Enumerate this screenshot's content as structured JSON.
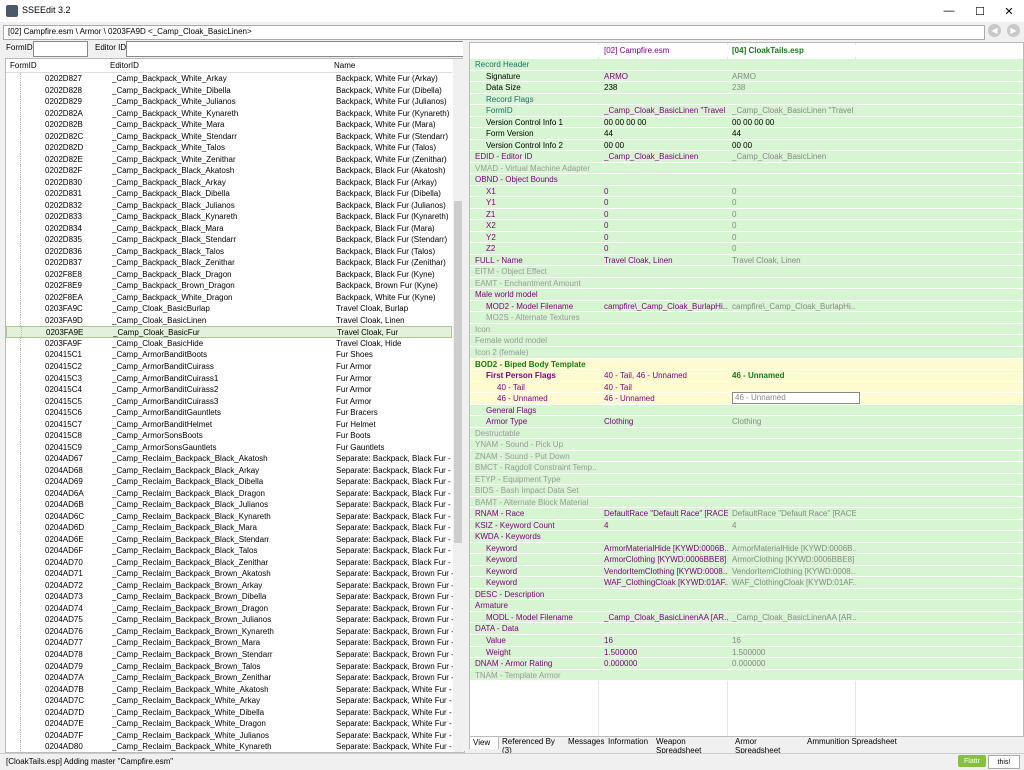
{
  "app": {
    "title": "SSEEdit 3.2"
  },
  "window_controls": {
    "minimize": "—",
    "maximize": "☐",
    "close": "✕"
  },
  "path": "[02] Campfire.esm \\ Armor \\ 0203FA9D <_Camp_Cloak_BasicLinen>",
  "filter": {
    "formid_label": "FormID",
    "editorid_label": "Editor ID",
    "formid_value": "",
    "editorid_value": ""
  },
  "left": {
    "headers": {
      "formid": "FormID",
      "editorid": "EditorID",
      "name": "Name"
    },
    "selected_index": 22,
    "rows": [
      [
        "0202D827",
        "_Camp_Backpack_White_Arkay",
        "Backpack, White Fur (Arkay)"
      ],
      [
        "0202D828",
        "_Camp_Backpack_White_Dibella",
        "Backpack, White Fur (Dibella)"
      ],
      [
        "0202D829",
        "_Camp_Backpack_White_Julianos",
        "Backpack, White Fur (Julianos)"
      ],
      [
        "0202D82A",
        "_Camp_Backpack_White_Kynareth",
        "Backpack, White Fur (Kynareth)"
      ],
      [
        "0202D82B",
        "_Camp_Backpack_White_Mara",
        "Backpack, White Fur (Mara)"
      ],
      [
        "0202D82C",
        "_Camp_Backpack_White_Stendarr",
        "Backpack, White Fur (Stendarr)"
      ],
      [
        "0202D82D",
        "_Camp_Backpack_White_Talos",
        "Backpack, White Fur (Talos)"
      ],
      [
        "0202D82E",
        "_Camp_Backpack_White_Zenithar",
        "Backpack, White Fur (Zenithar)"
      ],
      [
        "0202D82F",
        "_Camp_Backpack_Black_Akatosh",
        "Backpack, Black Fur (Akatosh)"
      ],
      [
        "0202D830",
        "_Camp_Backpack_Black_Arkay",
        "Backpack, Black Fur (Arkay)"
      ],
      [
        "0202D831",
        "_Camp_Backpack_Black_Dibella",
        "Backpack, Black Fur (Dibella)"
      ],
      [
        "0202D832",
        "_Camp_Backpack_Black_Julianos",
        "Backpack, Black Fur (Julianos)"
      ],
      [
        "0202D833",
        "_Camp_Backpack_Black_Kynareth",
        "Backpack, Black Fur (Kynareth)"
      ],
      [
        "0202D834",
        "_Camp_Backpack_Black_Mara",
        "Backpack, Black Fur (Mara)"
      ],
      [
        "0202D835",
        "_Camp_Backpack_Black_Stendarr",
        "Backpack, Black Fur (Stendarr)"
      ],
      [
        "0202D836",
        "_Camp_Backpack_Black_Talos",
        "Backpack, Black Fur (Talos)"
      ],
      [
        "0202D837",
        "_Camp_Backpack_Black_Zenithar",
        "Backpack, Black Fur (Zenithar)"
      ],
      [
        "0202F8E8",
        "_Camp_Backpack_Black_Dragon",
        "Backpack, Black Fur (Kyne)"
      ],
      [
        "0202F8E9",
        "_Camp_Backpack_Brown_Dragon",
        "Backpack, Brown Fur (Kyne)"
      ],
      [
        "0202F8EA",
        "_Camp_Backpack_White_Dragon",
        "Backpack, White Fur (Kyne)"
      ],
      [
        "0203FA9C",
        "_Camp_Cloak_BasicBurlap",
        "Travel Cloak, Burlap"
      ],
      [
        "0203FA9D",
        "_Camp_Cloak_BasicLinen",
        "Travel Cloak, Linen"
      ],
      [
        "0203FA9E",
        "_Camp_Cloak_BasicFur",
        "Travel Cloak, Fur"
      ],
      [
        "0203FA9F",
        "_Camp_Cloak_BasicHide",
        "Travel Cloak, Hide"
      ],
      [
        "020415C1",
        "_Camp_ArmorBanditBoots",
        "Fur Shoes"
      ],
      [
        "020415C2",
        "_Camp_ArmorBanditCuirass",
        "Fur Armor"
      ],
      [
        "020415C3",
        "_Camp_ArmorBanditCuirass1",
        "Fur Armor"
      ],
      [
        "020415C4",
        "_Camp_ArmorBanditCuirass2",
        "Fur Armor"
      ],
      [
        "020415C5",
        "_Camp_ArmorBanditCuirass3",
        "Fur Armor"
      ],
      [
        "020415C6",
        "_Camp_ArmorBanditGauntlets",
        "Fur Bracers"
      ],
      [
        "020415C7",
        "_Camp_ArmorBanditHelmet",
        "Fur Helmet"
      ],
      [
        "020415C8",
        "_Camp_ArmorSonsBoots",
        "Fur Boots"
      ],
      [
        "020415C9",
        "_Camp_ArmorSonsGauntlets",
        "Fur Gauntlets"
      ],
      [
        "0204AD67",
        "_Camp_Reclaim_Backpack_Black_Akatosh",
        "Separate: Backpack, Black Fur - ..."
      ],
      [
        "0204AD68",
        "_Camp_Reclaim_Backpack_Black_Arkay",
        "Separate: Backpack, Black Fur - ..."
      ],
      [
        "0204AD69",
        "_Camp_Reclaim_Backpack_Black_Dibella",
        "Separate: Backpack, Black Fur - ..."
      ],
      [
        "0204AD6A",
        "_Camp_Reclaim_Backpack_Black_Dragon",
        "Separate: Backpack, Black Fur - ..."
      ],
      [
        "0204AD6B",
        "_Camp_Reclaim_Backpack_Black_Julianos",
        "Separate: Backpack, Black Fur - ..."
      ],
      [
        "0204AD6C",
        "_Camp_Reclaim_Backpack_Black_Kynareth",
        "Separate: Backpack, Black Fur - ..."
      ],
      [
        "0204AD6D",
        "_Camp_Reclaim_Backpack_Black_Mara",
        "Separate: Backpack, Black Fur - ..."
      ],
      [
        "0204AD6E",
        "_Camp_Reclaim_Backpack_Black_Stendarr",
        "Separate: Backpack, Black Fur - ..."
      ],
      [
        "0204AD6F",
        "_Camp_Reclaim_Backpack_Black_Talos",
        "Separate: Backpack, Black Fur - ..."
      ],
      [
        "0204AD70",
        "_Camp_Reclaim_Backpack_Black_Zenithar",
        "Separate: Backpack, Black Fur - ..."
      ],
      [
        "0204AD71",
        "_Camp_Reclaim_Backpack_Brown_Akatosh",
        "Separate: Backpack, Brown Fur - ..."
      ],
      [
        "0204AD72",
        "_Camp_Reclaim_Backpack_Brown_Arkay",
        "Separate: Backpack, Brown Fur - ..."
      ],
      [
        "0204AD73",
        "_Camp_Reclaim_Backpack_Brown_Dibella",
        "Separate: Backpack, Brown Fur - ..."
      ],
      [
        "0204AD74",
        "_Camp_Reclaim_Backpack_Brown_Dragon",
        "Separate: Backpack, Brown Fur - ..."
      ],
      [
        "0204AD75",
        "_Camp_Reclaim_Backpack_Brown_Julianos",
        "Separate: Backpack, Brown Fur - ..."
      ],
      [
        "0204AD76",
        "_Camp_Reclaim_Backpack_Brown_Kynareth",
        "Separate: Backpack, Brown Fur - ..."
      ],
      [
        "0204AD77",
        "_Camp_Reclaim_Backpack_Brown_Mara",
        "Separate: Backpack, Brown Fur - ..."
      ],
      [
        "0204AD78",
        "_Camp_Reclaim_Backpack_Brown_Stendarr",
        "Separate: Backpack, Brown Fur - ..."
      ],
      [
        "0204AD79",
        "_Camp_Reclaim_Backpack_Brown_Talos",
        "Separate: Backpack, Brown Fur - ..."
      ],
      [
        "0204AD7A",
        "_Camp_Reclaim_Backpack_Brown_Zenithar",
        "Separate: Backpack, Brown Fur - ..."
      ],
      [
        "0204AD7B",
        "_Camp_Reclaim_Backpack_White_Akatosh",
        "Separate: Backpack, White Fur - ..."
      ],
      [
        "0204AD7C",
        "_Camp_Reclaim_Backpack_White_Arkay",
        "Separate: Backpack, White Fur - ..."
      ],
      [
        "0204AD7D",
        "_Camp_Reclaim_Backpack_White_Dibella",
        "Separate: Backpack, White Fur - ..."
      ],
      [
        "0204AD7E",
        "_Camp_Reclaim_Backpack_White_Dragon",
        "Separate: Backpack, White Fur - ..."
      ],
      [
        "0204AD7F",
        "_Camp_Reclaim_Backpack_White_Julianos",
        "Separate: Backpack, White Fur - ..."
      ],
      [
        "0204AD80",
        "_Camp_Reclaim_Backpack_White_Kynareth",
        "Separate: Backpack, White Fur - ..."
      ]
    ]
  },
  "right": {
    "col1_header": "[02] Campfire.esm",
    "col2_header": "[04] CloakTails.esp",
    "rows": [
      {
        "label": "Record Header",
        "v1": "",
        "v2": "",
        "bg": "g",
        "lc": "teal",
        "indent": 0
      },
      {
        "label": "Signature",
        "v1": "ARMO",
        "v2": "ARMO",
        "bg": "g",
        "lc": "",
        "indent": 1,
        "v1c": "purp",
        "v2c": "grey"
      },
      {
        "label": "Data Size",
        "v1": "238",
        "v2": "238",
        "bg": "g",
        "lc": "",
        "indent": 1,
        "v2c": "grey"
      },
      {
        "label": "Record Flags",
        "v1": "",
        "v2": "",
        "bg": "g",
        "lc": "teal",
        "indent": 1
      },
      {
        "label": "FormID",
        "v1": "_Camp_Cloak_BasicLinen \"Travel ...",
        "v2": "_Camp_Cloak_BasicLinen \"Travel ...",
        "bg": "g",
        "lc": "teal",
        "indent": 1,
        "v1c": "purp",
        "v2c": "grey"
      },
      {
        "label": "Version Control Info 1",
        "v1": "00 00 00 00",
        "v2": "00 00 00 00",
        "bg": "g",
        "lc": "",
        "indent": 1
      },
      {
        "label": "Form Version",
        "v1": "44",
        "v2": "44",
        "bg": "g",
        "lc": "",
        "indent": 1
      },
      {
        "label": "Version Control Info 2",
        "v1": "00 00",
        "v2": "00 00",
        "bg": "g",
        "lc": "",
        "indent": 1
      },
      {
        "label": "EDID - Editor ID",
        "v1": "_Camp_Cloak_BasicLinen",
        "v2": "_Camp_Cloak_BasicLinen",
        "bg": "g",
        "lc": "purp",
        "indent": 0,
        "v1c": "purp",
        "v2c": "grey"
      },
      {
        "label": "VMAD - Virtual Machine Adapter",
        "v1": "",
        "v2": "",
        "bg": "g",
        "lc": "dim",
        "indent": 0
      },
      {
        "label": "OBND - Object Bounds",
        "v1": "",
        "v2": "",
        "bg": "g",
        "lc": "purp",
        "indent": 0
      },
      {
        "label": "X1",
        "v1": "0",
        "v2": "0",
        "bg": "g",
        "lc": "purp",
        "indent": 1,
        "v1c": "purp",
        "v2c": "grey"
      },
      {
        "label": "Y1",
        "v1": "0",
        "v2": "0",
        "bg": "g",
        "lc": "purp",
        "indent": 1,
        "v1c": "purp",
        "v2c": "grey"
      },
      {
        "label": "Z1",
        "v1": "0",
        "v2": "0",
        "bg": "g",
        "lc": "purp",
        "indent": 1,
        "v1c": "purp",
        "v2c": "grey"
      },
      {
        "label": "X2",
        "v1": "0",
        "v2": "0",
        "bg": "g",
        "lc": "purp",
        "indent": 1,
        "v1c": "purp",
        "v2c": "grey"
      },
      {
        "label": "Y2",
        "v1": "0",
        "v2": "0",
        "bg": "g",
        "lc": "purp",
        "indent": 1,
        "v1c": "purp",
        "v2c": "grey"
      },
      {
        "label": "Z2",
        "v1": "0",
        "v2": "0",
        "bg": "g",
        "lc": "purp",
        "indent": 1,
        "v1c": "purp",
        "v2c": "grey"
      },
      {
        "label": "FULL - Name",
        "v1": "Travel Cloak, Linen",
        "v2": "Travel Cloak, Linen",
        "bg": "g",
        "lc": "purp",
        "indent": 0,
        "v1c": "purp",
        "v2c": "grey"
      },
      {
        "label": "EITM - Object Effect",
        "v1": "",
        "v2": "",
        "bg": "g",
        "lc": "dim",
        "indent": 0
      },
      {
        "label": "EAMT - Enchantment Amount",
        "v1": "",
        "v2": "",
        "bg": "g",
        "lc": "dim",
        "indent": 0
      },
      {
        "label": "Male world model",
        "v1": "",
        "v2": "",
        "bg": "g",
        "lc": "purp",
        "indent": 0
      },
      {
        "label": "MOD2 - Model Filename",
        "v1": "campfire\\_Camp_Cloak_BurlapHi...",
        "v2": "campfire\\_Camp_Cloak_BurlapHi...",
        "bg": "g",
        "lc": "purp",
        "indent": 1,
        "v1c": "purp",
        "v2c": "grey"
      },
      {
        "label": "MO2S - Alternate Textures",
        "v1": "",
        "v2": "",
        "bg": "g",
        "lc": "dim",
        "indent": 1
      },
      {
        "label": "Icon",
        "v1": "",
        "v2": "",
        "bg": "g",
        "lc": "dim",
        "indent": 0
      },
      {
        "label": "Female world model",
        "v1": "",
        "v2": "",
        "bg": "g",
        "lc": "dim",
        "indent": 0
      },
      {
        "label": "Icon 2 (female)",
        "v1": "",
        "v2": "",
        "bg": "g",
        "lc": "dim",
        "indent": 0
      },
      {
        "label": "BOD2 - Biped Body Template",
        "v1": "",
        "v2": "",
        "bg": "y",
        "lc": "boldg",
        "indent": 0
      },
      {
        "label": "First Person Flags",
        "v1": "40 - Tail, 46 - Unnamed",
        "v2": "46 - Unnamed",
        "bg": "y",
        "lc": "boldp",
        "indent": 1,
        "v1c": "purp",
        "v2c": "boldg"
      },
      {
        "label": "40 - Tail",
        "v1": "40 - Tail",
        "v2": "",
        "bg": "y",
        "lc": "purp",
        "indent": 2,
        "v1c": "purp"
      },
      {
        "label": "46 - Unnamed",
        "v1": "46 - Unnamed",
        "v2": "46 - Unnamed",
        "bg": "y",
        "lc": "purp",
        "indent": 2,
        "v1c": "purp",
        "v2c": "grey",
        "v2box": true
      },
      {
        "label": "General Flags",
        "v1": "",
        "v2": "",
        "bg": "g",
        "lc": "purp",
        "indent": 1
      },
      {
        "label": "Armor Type",
        "v1": "Clothing",
        "v2": "Clothing",
        "bg": "g",
        "lc": "purp",
        "indent": 1,
        "v1c": "purp",
        "v2c": "grey"
      },
      {
        "label": "Destructable",
        "v1": "",
        "v2": "",
        "bg": "g",
        "lc": "dim",
        "indent": 0
      },
      {
        "label": "YNAM - Sound - Pick Up",
        "v1": "",
        "v2": "",
        "bg": "g",
        "lc": "dim",
        "indent": 0
      },
      {
        "label": "ZNAM - Sound - Put Down",
        "v1": "",
        "v2": "",
        "bg": "g",
        "lc": "dim",
        "indent": 0
      },
      {
        "label": "BMCT - Ragdoll Constraint Temp...",
        "v1": "",
        "v2": "",
        "bg": "g",
        "lc": "dim",
        "indent": 0
      },
      {
        "label": "ETYP - Equipment Type",
        "v1": "",
        "v2": "",
        "bg": "g",
        "lc": "dim",
        "indent": 0
      },
      {
        "label": "BIDS - Bash Impact Data Set",
        "v1": "",
        "v2": "",
        "bg": "g",
        "lc": "dim",
        "indent": 0
      },
      {
        "label": "BAMT - Alternate Block Material",
        "v1": "",
        "v2": "",
        "bg": "g",
        "lc": "dim",
        "indent": 0
      },
      {
        "label": "RNAM - Race",
        "v1": "DefaultRace \"Default Race\" [RACE...",
        "v2": "DefaultRace \"Default Race\" [RACE...",
        "bg": "g",
        "lc": "purp",
        "indent": 0,
        "v1c": "purp",
        "v2c": "grey"
      },
      {
        "label": "KSIZ - Keyword Count",
        "v1": "4",
        "v2": "4",
        "bg": "g",
        "lc": "purp",
        "indent": 0,
        "v1c": "purp",
        "v2c": "grey"
      },
      {
        "label": "KWDA - Keywords",
        "v1": "",
        "v2": "",
        "bg": "g",
        "lc": "purp",
        "indent": 0
      },
      {
        "label": "Keyword",
        "v1": "ArmorMaterialHide [KYWD:0006B...",
        "v2": "ArmorMaterialHide [KYWD:0006B...",
        "bg": "g",
        "lc": "purp",
        "indent": 1,
        "v1c": "purp",
        "v2c": "grey"
      },
      {
        "label": "Keyword",
        "v1": "ArmorClothing [KYWD:0006BBE8]",
        "v2": "ArmorClothing [KYWD:0006BBE8]",
        "bg": "g",
        "lc": "purp",
        "indent": 1,
        "v1c": "purp",
        "v2c": "grey"
      },
      {
        "label": "Keyword",
        "v1": "VendorItemClothing [KYWD:0008...",
        "v2": "VendorItemClothing [KYWD:0008...",
        "bg": "g",
        "lc": "purp",
        "indent": 1,
        "v1c": "purp",
        "v2c": "grey"
      },
      {
        "label": "Keyword",
        "v1": "WAF_ClothingCloak [KYWD:01AF...",
        "v2": "WAF_ClothingCloak [KYWD:01AF...",
        "bg": "g",
        "lc": "purp",
        "indent": 1,
        "v1c": "purp",
        "v2c": "grey"
      },
      {
        "label": "DESC - Description",
        "v1": "",
        "v2": "",
        "bg": "g",
        "lc": "purp",
        "indent": 0
      },
      {
        "label": "Armature",
        "v1": "",
        "v2": "",
        "bg": "g",
        "lc": "purp",
        "indent": 0
      },
      {
        "label": "MODL - Model Filename",
        "v1": "_Camp_Cloak_BasicLinenAA [AR...",
        "v2": "_Camp_Cloak_BasicLinenAA [AR...",
        "bg": "g",
        "lc": "purp",
        "indent": 1,
        "v1c": "purp",
        "v2c": "grey"
      },
      {
        "label": "DATA - Data",
        "v1": "",
        "v2": "",
        "bg": "g",
        "lc": "purp",
        "indent": 0
      },
      {
        "label": "Value",
        "v1": "16",
        "v2": "16",
        "bg": "g",
        "lc": "purp",
        "indent": 1,
        "v1c": "purp",
        "v2c": "grey"
      },
      {
        "label": "Weight",
        "v1": "1.500000",
        "v2": "1.500000",
        "bg": "g",
        "lc": "purp",
        "indent": 1,
        "v1c": "purp",
        "v2c": "grey"
      },
      {
        "label": "DNAM - Armor Rating",
        "v1": "0.000000",
        "v2": "0.000000",
        "bg": "g",
        "lc": "purp",
        "indent": 0,
        "v1c": "purp",
        "v2c": "grey"
      },
      {
        "label": "TNAM - Template Armor",
        "v1": "",
        "v2": "",
        "bg": "g",
        "lc": "dim",
        "indent": 0
      }
    ]
  },
  "tabs": [
    "View",
    "Referenced By (3)",
    "Messages",
    "Information",
    "Weapon Spreadsheet",
    "Armor Spreadsheet",
    "Ammunition Spreadsheet"
  ],
  "status": {
    "text": "[CloakTails.esp] Adding master \"Campfire.esm\"",
    "flattr": "Flattr",
    "this": "this!"
  },
  "colors": {
    "green_row": "#d7f5d2",
    "yellow_row": "#fffbd0",
    "purple_text": "#800080",
    "teal_text": "#1e6f6e"
  }
}
